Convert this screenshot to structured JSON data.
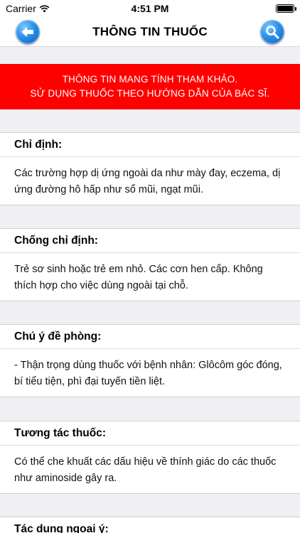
{
  "status_bar": {
    "carrier": "Carrier",
    "time": "4:51 PM"
  },
  "nav": {
    "title": "THÔNG TIN THUỐC"
  },
  "warning": {
    "line1": "THÔNG TIN MANG TÍNH THAM KHẢO.",
    "line2": "SỬ DỤNG THUỐC THEO HƯỚNG DẪN CỦA BÁC SĨ."
  },
  "sections": [
    {
      "title": "Chỉ định:",
      "body": "Các trường hợp dị ứng ngoài da như mày đay, eczema, dị ứng đường hô hấp như sổ mũi, ngạt mũi."
    },
    {
      "title": "Chống chỉ định:",
      "body": "Trẻ sơ sinh hoặc trẻ em nhỏ. Các cơn hen cấp. Không thích hợp cho việc dùng ngoài tại chỗ."
    },
    {
      "title": "Chú ý đề phòng:",
      "body": "- Thận trọng dùng thuốc với bệnh nhân: Glôcôm góc đóng, bí tiểu tiện, phì đại tuyến tiền liệt."
    },
    {
      "title": "Tương tác thuốc:",
      "body": "Có thể che khuất các dấu hiệu về thính giác do các thuốc như aminoside gây ra."
    },
    {
      "title": "Tác dụng ngoại ý:",
      "body": ""
    }
  ],
  "colors": {
    "warning_bg": "#ff0000",
    "accent_blue": "#1f7fe0",
    "page_bg": "#efeff4"
  },
  "icons": {
    "back": "back-arrow-icon",
    "search": "search-icon",
    "wifi": "wifi-icon",
    "battery": "battery-icon"
  }
}
